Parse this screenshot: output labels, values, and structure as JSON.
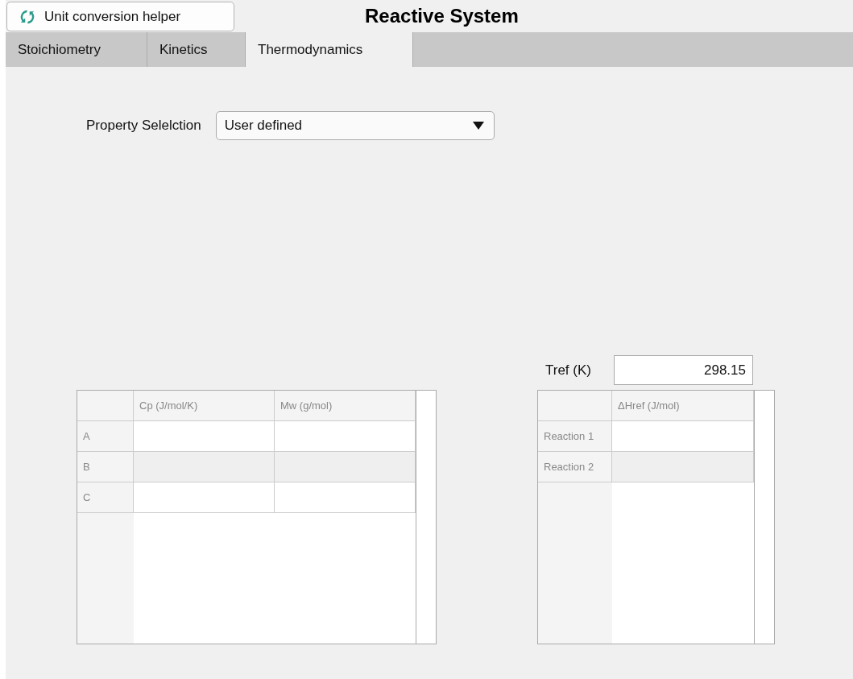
{
  "helper_button": {
    "label": "Unit conversion helper"
  },
  "window": {
    "title": "Reactive System"
  },
  "tabs": [
    {
      "label": "Stoichiometry",
      "selected": false
    },
    {
      "label": "Kinetics",
      "selected": false
    },
    {
      "label": "Thermodynamics",
      "selected": true
    }
  ],
  "property_selection": {
    "label": "Property Selelction",
    "value": "User defined"
  },
  "tref": {
    "label": "Tref (K)",
    "value": "298.15"
  },
  "species_table": {
    "columns": [
      "Cp (J/mol/K)",
      "Mw (g/mol)"
    ],
    "rows": [
      {
        "header": "A"
      },
      {
        "header": "B"
      },
      {
        "header": "C"
      }
    ]
  },
  "reaction_table": {
    "columns": [
      "ΔHref (J/mol)"
    ],
    "rows": [
      {
        "header": "Reaction 1"
      },
      {
        "header": "Reaction 2"
      }
    ]
  }
}
